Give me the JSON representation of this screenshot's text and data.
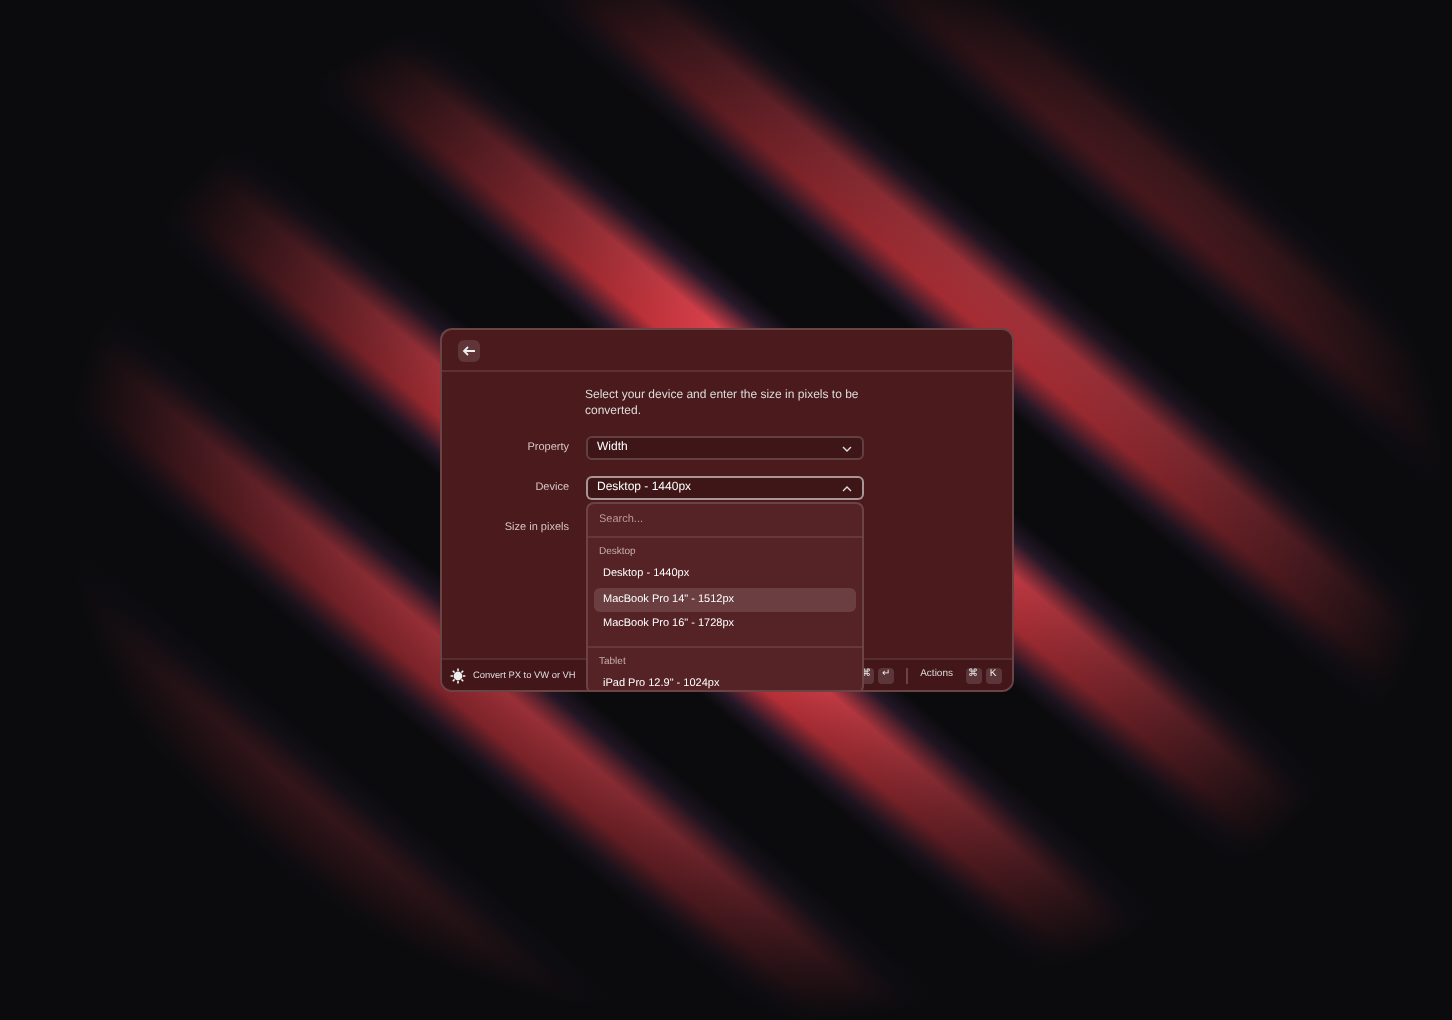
{
  "description": "Select your device and enter the size in pixels to be converted.",
  "fields": [
    {
      "label": "Property",
      "kind": "dropdown",
      "value": "Width",
      "focused": false
    },
    {
      "label": "Device",
      "kind": "dropdown",
      "value": "Desktop - 1440px",
      "focused": true
    },
    {
      "label": "Size in pixels",
      "kind": "text"
    }
  ],
  "dropdown": {
    "placeholder": "Search...",
    "sections": [
      {
        "title": "Desktop",
        "items": [
          {
            "label": "Desktop - 1440px",
            "selected": false
          },
          {
            "label": "MacBook Pro 14\" - 1512px",
            "selected": true
          },
          {
            "label": "MacBook Pro 16\" - 1728px",
            "selected": false
          }
        ]
      },
      {
        "title": "Tablet",
        "items": [
          {
            "label": "iPad Pro 12.9\" - 1024px",
            "selected": false
          }
        ]
      }
    ]
  },
  "footer": {
    "title": "Convert PX to VW or VH",
    "primary_keys": [
      "⌘",
      "↵"
    ],
    "actions_label": "Actions",
    "actions_keys": [
      "⌘",
      "K"
    ]
  }
}
